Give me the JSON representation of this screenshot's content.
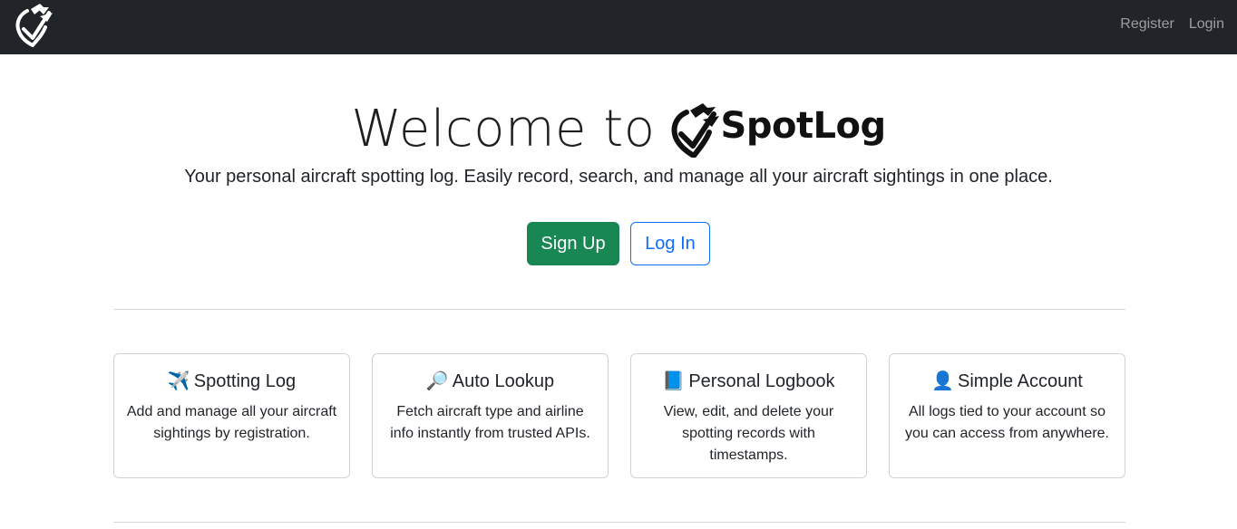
{
  "nav": {
    "logo_icon": "spotlog-plane-pin-icon",
    "links": [
      "Register",
      "Login"
    ]
  },
  "hero": {
    "title_prefix": "Welcome to",
    "brand_name": "SpotLog",
    "lead": "Your personal aircraft spotting log. Easily record, search, and manage all your aircraft sightings in one place."
  },
  "buttons": {
    "signup": "Sign Up",
    "login": "Log In"
  },
  "features": [
    {
      "emoji": "✈️",
      "title": "Spotting Log",
      "text": "Add and manage all your aircraft sightings by registration."
    },
    {
      "emoji": "🔎",
      "title": "Auto Lookup",
      "text": "Fetch aircraft type and airline info instantly from trusted APIs."
    },
    {
      "emoji": "📘",
      "title": "Personal Logbook",
      "text": "View, edit, and delete your spotting records with timestamps."
    },
    {
      "emoji": "👤",
      "title": "Simple Account",
      "text": "All logs tied to your account so you can access from anywhere."
    }
  ],
  "colors": {
    "navbar": "#212529",
    "signup": "#198754",
    "login": "#0d6efd"
  }
}
